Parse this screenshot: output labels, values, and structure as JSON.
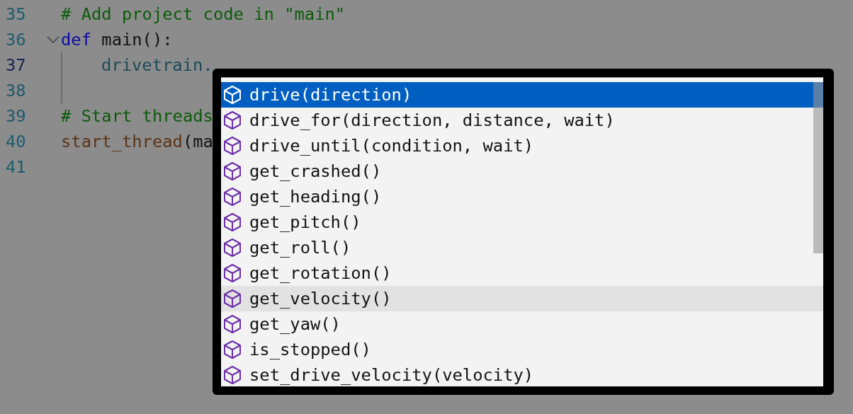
{
  "editor": {
    "lines": [
      {
        "number": "35",
        "current": false,
        "tokens": [
          {
            "kind": "comment",
            "text": "# Add project code in \"main\""
          }
        ]
      },
      {
        "number": "36",
        "current": false,
        "foldable": true,
        "tokens": [
          {
            "kind": "keyword",
            "text": "def"
          },
          {
            "kind": "plain",
            "text": " main():"
          }
        ]
      },
      {
        "number": "37",
        "current": true,
        "guide": true,
        "indented": true,
        "tokens": [
          {
            "kind": "variable",
            "text": "drivetrain."
          }
        ]
      },
      {
        "number": "38",
        "current": false,
        "guide": true
      },
      {
        "number": "39",
        "current": false,
        "tokens": [
          {
            "kind": "comment",
            "text": "# Start threads"
          }
        ]
      },
      {
        "number": "40",
        "current": false,
        "tokens": [
          {
            "kind": "function",
            "text": "start_thread"
          },
          {
            "kind": "plain",
            "text": "(ma"
          }
        ]
      },
      {
        "number": "41",
        "current": false
      }
    ]
  },
  "suggestions": {
    "items": [
      {
        "label": "drive(direction)",
        "selected": true
      },
      {
        "label": "drive_for(direction, distance, wait)",
        "selected": false
      },
      {
        "label": "drive_until(condition, wait)",
        "selected": false
      },
      {
        "label": "get_crashed()",
        "selected": false
      },
      {
        "label": "get_heading()",
        "selected": false
      },
      {
        "label": "get_pitch()",
        "selected": false
      },
      {
        "label": "get_roll()",
        "selected": false
      },
      {
        "label": "get_rotation()",
        "selected": false
      },
      {
        "label": "get_velocity()",
        "selected": false,
        "hovered": true
      },
      {
        "label": "get_yaw()",
        "selected": false
      },
      {
        "label": "is_stopped()",
        "selected": false
      },
      {
        "label": "set_drive_velocity(velocity)",
        "selected": false
      }
    ]
  }
}
